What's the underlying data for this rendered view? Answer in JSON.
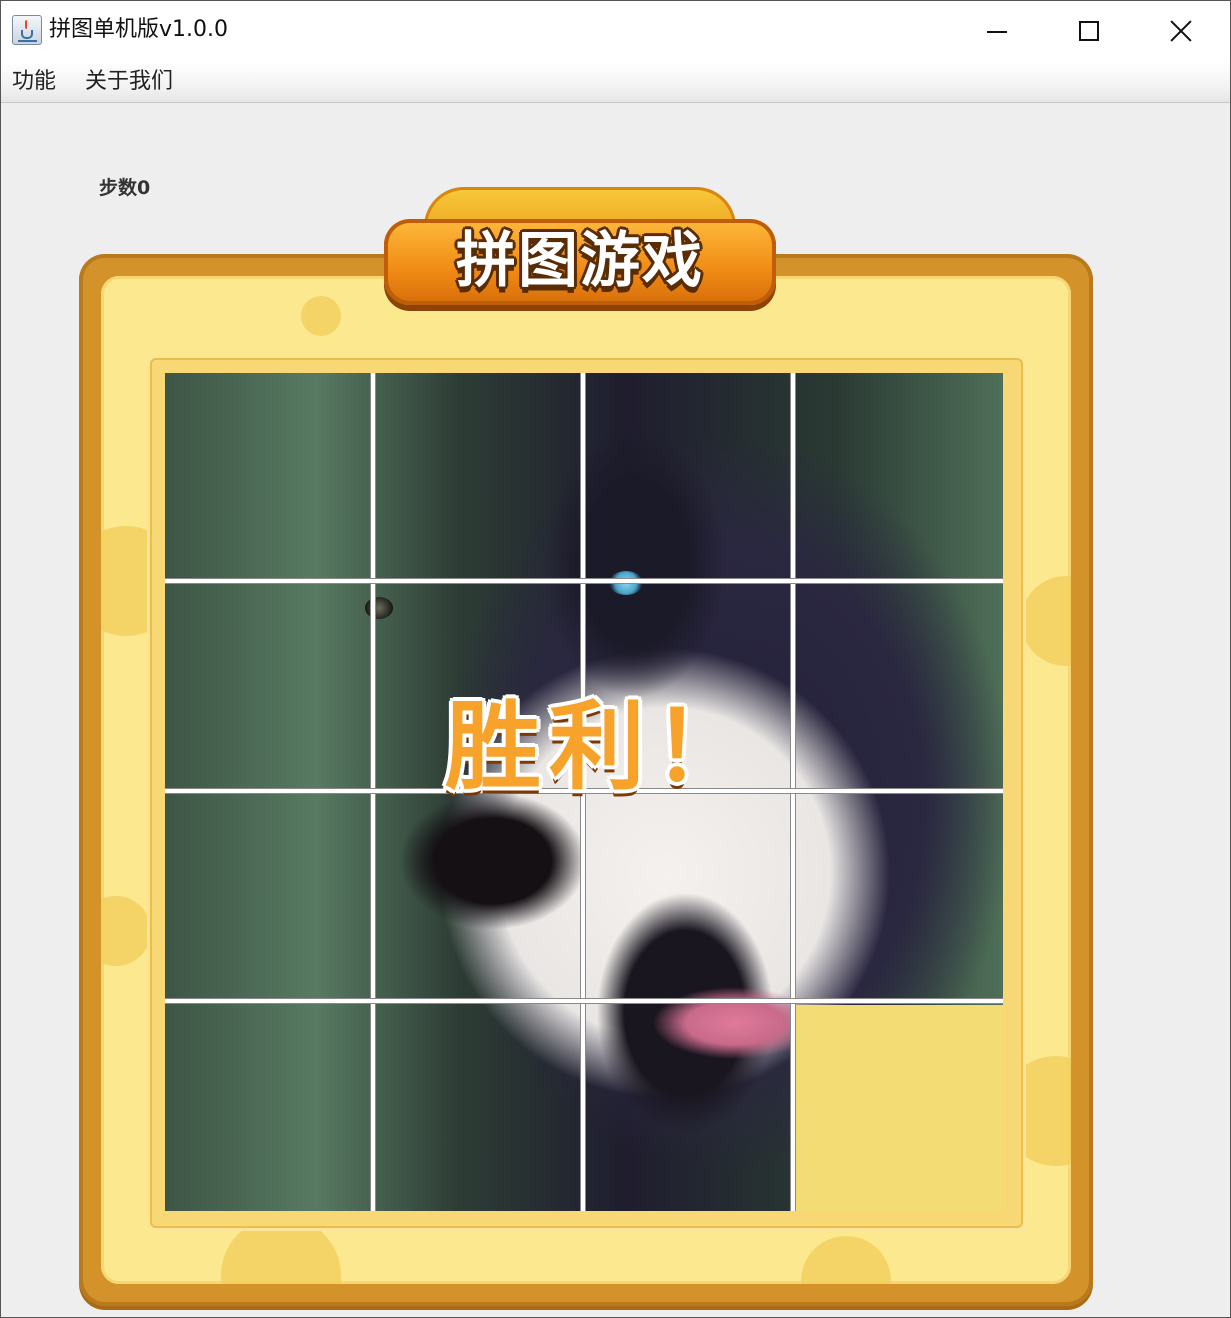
{
  "window": {
    "title": "拼图单机版v1.0.0",
    "controls": [
      "minimize",
      "maximize",
      "close"
    ]
  },
  "menu": {
    "items": [
      {
        "label": "功能"
      },
      {
        "label": "关于我们"
      }
    ]
  },
  "game": {
    "steps_label": "步数0",
    "banner_title": "拼图游戏",
    "victory_text": "胜利！",
    "grid": {
      "rows": 4,
      "cols": 4,
      "empty_tile": "row 4, col 4"
    },
    "image_subject": "husky"
  },
  "colors": {
    "frame": "#d4922b",
    "frame_inner": "#fbe88f",
    "banner": "#f08a14",
    "victory_text": "#f7a22a",
    "empty_tile": "#f4dc75"
  },
  "icons": [
    "java-coffee-icon",
    "minimize-icon",
    "maximize-icon",
    "close-icon"
  ]
}
